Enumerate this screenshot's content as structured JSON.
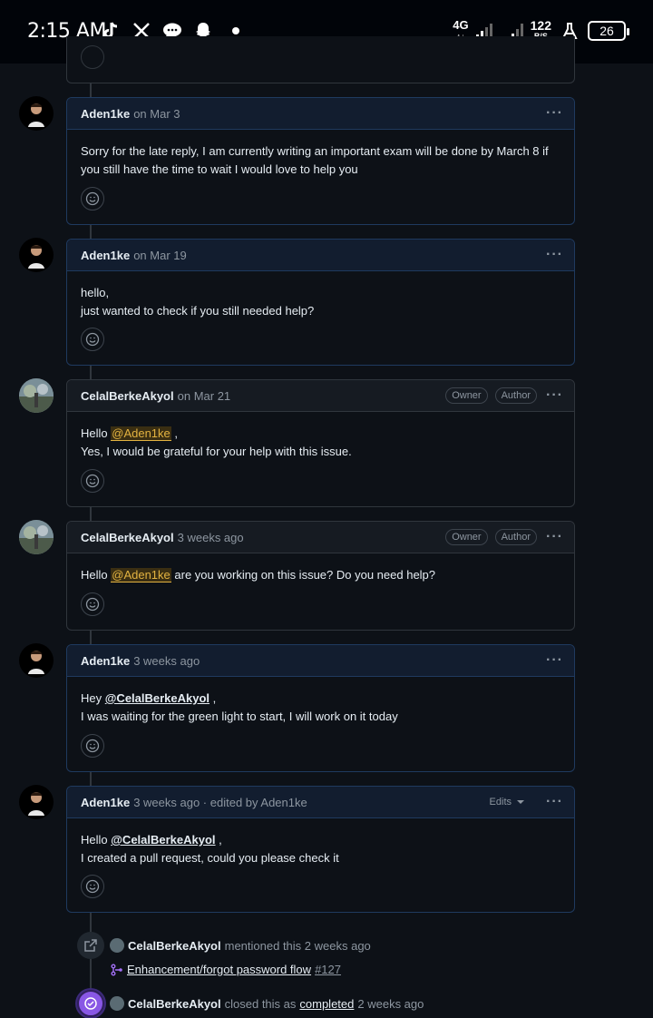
{
  "status_bar": {
    "time": "2:15 AM",
    "net_label": "4G",
    "net_sub": "↑↓",
    "speed": "122",
    "speed_unit": "B/S",
    "battery": "26",
    "icons": [
      "tiktok-icon",
      "x-icon",
      "chat-icon",
      "snapchat-icon"
    ]
  },
  "comments": [
    {
      "author": "Aden1ke",
      "meta": "on Mar 3",
      "lines": [
        "Sorry for the late reply, I am currently writing an important exam will be done by March 8 if you still have the time to wait I would love to help you"
      ]
    },
    {
      "author": "Aden1ke",
      "meta": "on Mar 19",
      "lines": [
        "hello,",
        "just wanted to check if you still needed help?"
      ]
    },
    {
      "author": "CelalBerkeAkyol",
      "meta": "on Mar 21",
      "badges": [
        "Owner",
        "Author"
      ],
      "greeting": "Hello",
      "mention": "@Aden1ke",
      "after_mention": " ,",
      "line2": "Yes, I would be grateful for your help with this issue."
    },
    {
      "author": "CelalBerkeAkyol",
      "meta": "3 weeks ago",
      "badges": [
        "Owner",
        "Author"
      ],
      "greeting": "Hello",
      "mention": "@Aden1ke",
      "after_mention": " are you working on this issue? Do you need help?"
    },
    {
      "author": "Aden1ke",
      "meta": "3 weeks ago",
      "greeting": "Hey",
      "mention": "@CelalBerkeAkyol",
      "after_mention": " ,",
      "line2": "I was waiting for the green light to start, I will work on it today"
    },
    {
      "author": "Aden1ke",
      "meta": "3 weeks ago · edited by Aden1ke",
      "edits_label": "Edits",
      "greeting": "Hello",
      "mention": "@CelalBerkeAkyol",
      "after_mention": " ,",
      "line2": "I created a pull request, could you please check it"
    }
  ],
  "events": {
    "mentioned": {
      "author": "CelalBerkeAkyol",
      "text": "mentioned this 2 weeks ago",
      "pr_title": "Enhancement/forgot password flow",
      "pr_number": "#127"
    },
    "closed": {
      "author": "CelalBerkeAkyol",
      "text": "closed this as",
      "link": "completed",
      "time": "2 weeks ago"
    }
  },
  "colors": {
    "background": "#0d1117",
    "own_header": "#121d2f",
    "mention_highlight": "#e3b341",
    "closed_purple": "#8957e5"
  }
}
